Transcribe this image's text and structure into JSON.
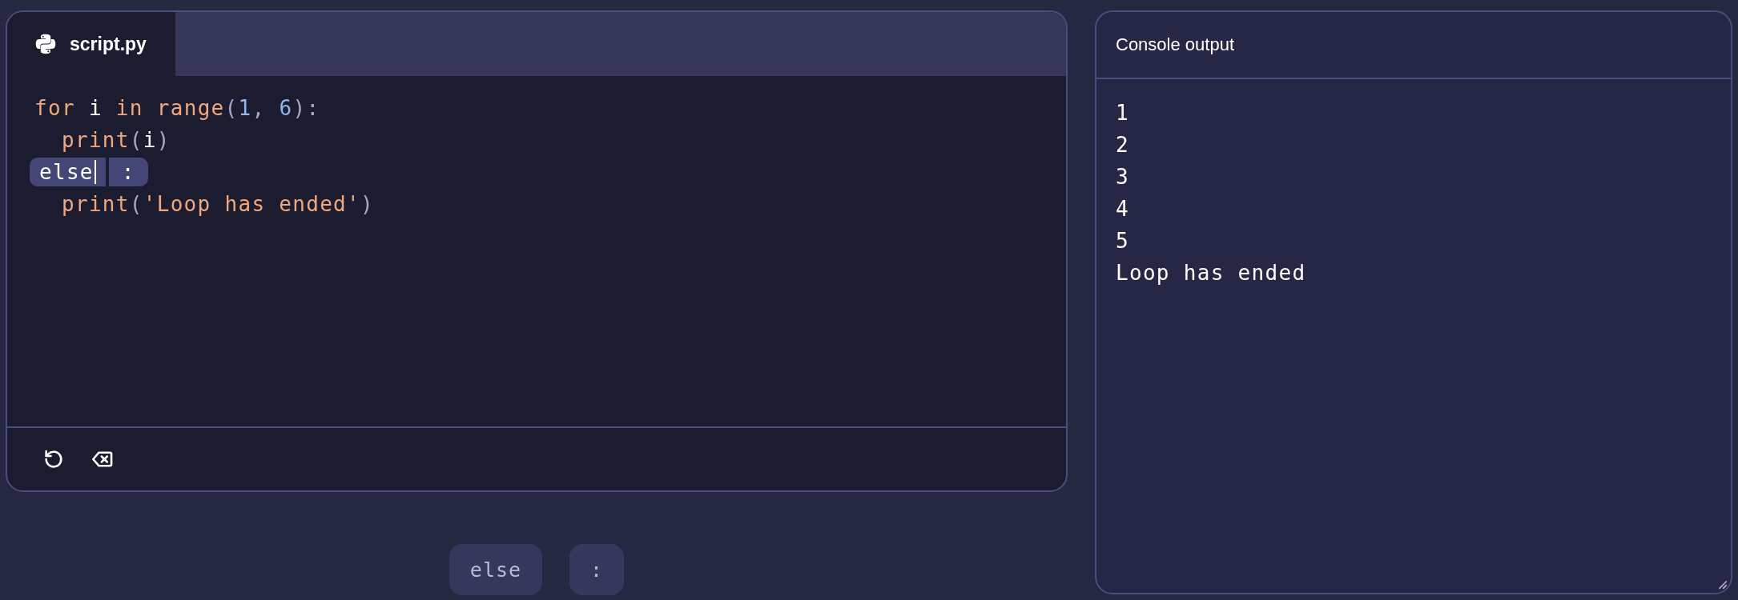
{
  "editor": {
    "tab": {
      "label": "script.py",
      "selected": true
    },
    "lines": [
      {
        "kind": "code",
        "tokens": [
          {
            "kind": "keyword",
            "text": "for"
          },
          {
            "kind": "name",
            "text": "i"
          },
          {
            "kind": "keyword",
            "text": "in"
          },
          {
            "kind": "func",
            "text": "range"
          },
          {
            "kind": "punct",
            "text": "("
          },
          {
            "kind": "number",
            "text": "1"
          },
          {
            "kind": "punct",
            "text": ","
          },
          {
            "kind": "number",
            "text": "6"
          },
          {
            "kind": "punct",
            "text": "):"
          }
        ],
        "children": [
          {
            "kind": "code",
            "tokens": [
              {
                "kind": "func",
                "text": "print"
              },
              {
                "kind": "punct",
                "text": "("
              },
              {
                "kind": "name",
                "text": "i"
              },
              {
                "kind": "punct",
                "text": ")"
              }
            ]
          }
        ]
      },
      {
        "kind": "slots",
        "slots": [
          {
            "text": "else",
            "cursor": true
          },
          {
            "text": ":",
            "cursor": false
          }
        ],
        "children": [
          {
            "kind": "code",
            "tokens": [
              {
                "kind": "func",
                "text": "print"
              },
              {
                "kind": "punct",
                "text": "("
              },
              {
                "kind": "string",
                "text": "'Loop has ended'"
              },
              {
                "kind": "punct",
                "text": ")"
              }
            ]
          }
        ]
      }
    ],
    "toolbar": [
      {
        "kind": "reset"
      },
      {
        "kind": "clear"
      }
    ]
  },
  "answer_options": [
    {
      "text": "else"
    },
    {
      "text": ":"
    }
  ],
  "console": {
    "title": "Console output",
    "lines": [
      "1",
      "2",
      "3",
      "4",
      "5",
      "Loop has ended"
    ]
  }
}
